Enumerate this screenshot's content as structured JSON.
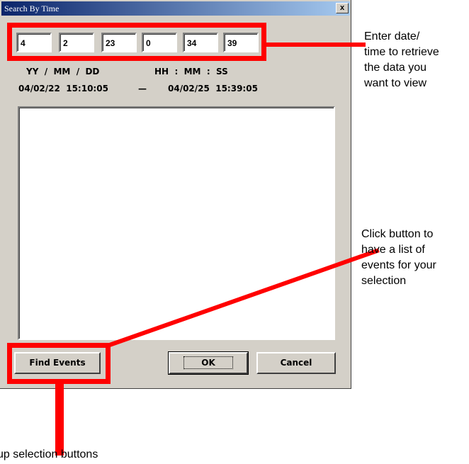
{
  "dialog": {
    "title": "Search By Time",
    "close_label": "x"
  },
  "fields": [
    "4",
    "2",
    "23",
    "0",
    "34",
    "39"
  ],
  "format_labels": {
    "date": "YY  /  MM  /  DD",
    "time": "HH  :  MM  :  SS"
  },
  "range": {
    "start": "04/02/22  15:10:05",
    "separator": "—",
    "end": "04/02/25  15:39:05"
  },
  "buttons": {
    "find_events": "Find Events",
    "ok": "OK",
    "cancel": "Cancel"
  },
  "annotations": {
    "enter_datetime": [
      "Enter date/",
      "time to retrieve",
      "the data you",
      "want to view"
    ],
    "click_button": [
      "Click button to",
      "have a list of",
      "events for your",
      "selection"
    ],
    "popup": "up selection buttons"
  },
  "colors": {
    "highlight": "#ff0000",
    "dialog_bg": "#d4d0c8",
    "title_bar": "#0a246a"
  }
}
